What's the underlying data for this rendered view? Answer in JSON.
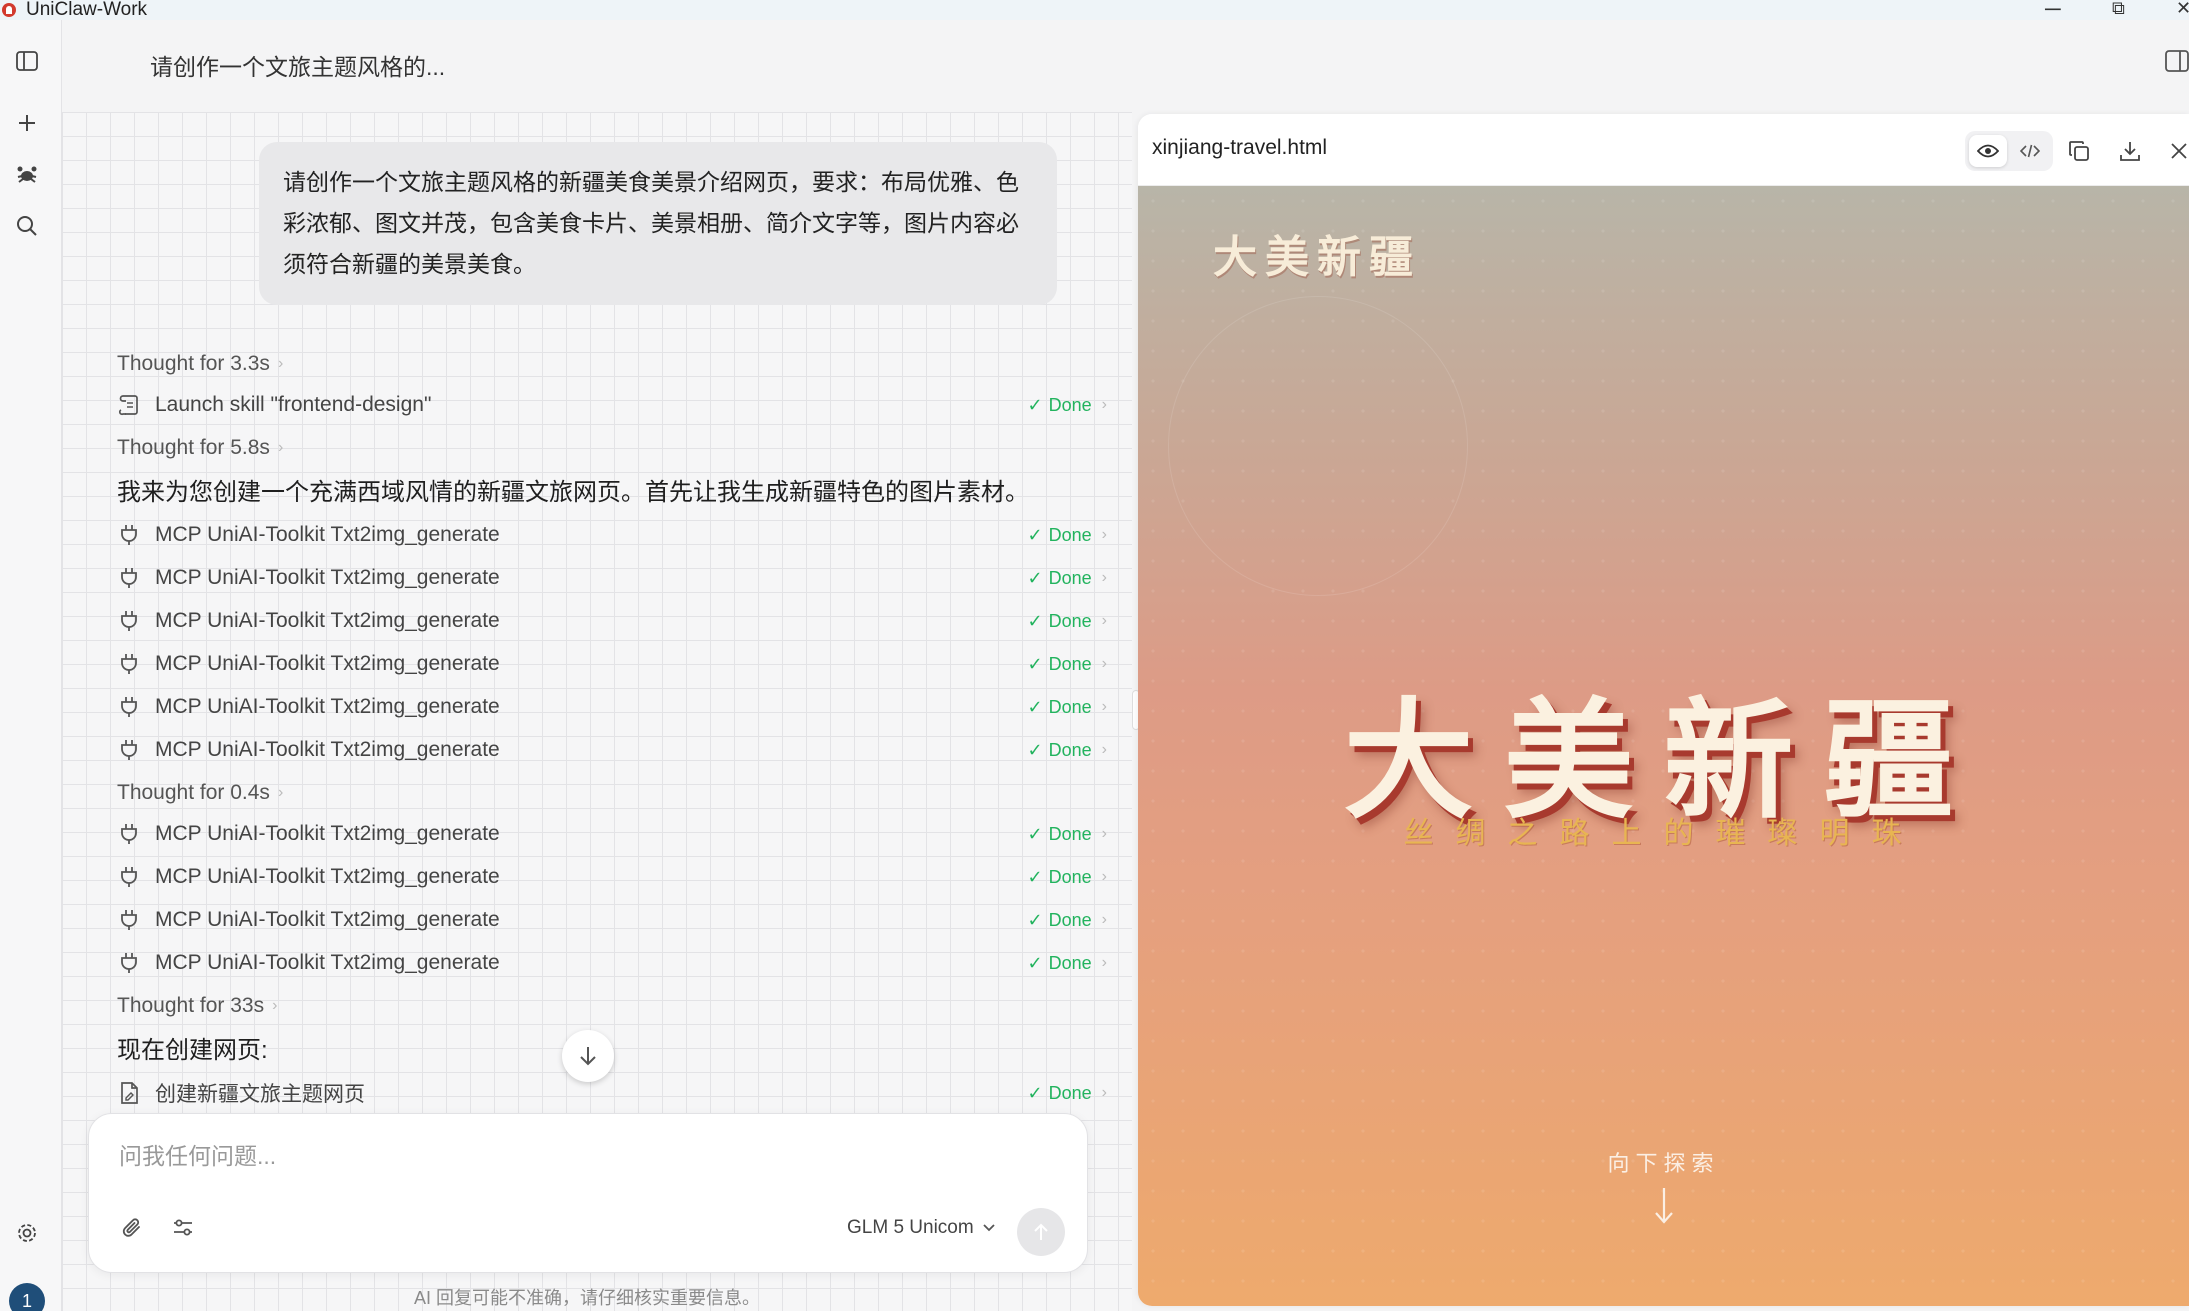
{
  "window": {
    "app_title": "UniClaw-Work",
    "minimize_glyph": "─",
    "restore_glyph": "⧉",
    "close_glyph": "✕"
  },
  "header": {
    "conversation_title": "请创作一个文旅主题风格的..."
  },
  "chat": {
    "user_message": "请创作一个文旅主题风格的新疆美食美景介绍网页，要求：布局优雅、色彩浓郁、图文并茂，包含美食卡片、美景相册、简介文字等，图片内容必须符合新疆的美景美食。",
    "items": [
      {
        "kind": "thought",
        "text": "Thought for 3.3s"
      },
      {
        "kind": "tool",
        "icon": "skill-icon",
        "text": "Launch skill \"frontend-design\"",
        "status": "Done"
      },
      {
        "kind": "thought",
        "text": "Thought for 5.8s"
      },
      {
        "kind": "prose",
        "text": "我来为您创建一个充满西域风情的新疆文旅网页。首先让我生成新疆特色的图片素材。"
      },
      {
        "kind": "tool",
        "icon": "plug-icon",
        "text": "MCP UniAI-Toolkit Txt2img_generate",
        "status": "Done"
      },
      {
        "kind": "tool",
        "icon": "plug-icon",
        "text": "MCP UniAI-Toolkit Txt2img_generate",
        "status": "Done"
      },
      {
        "kind": "tool",
        "icon": "plug-icon",
        "text": "MCP UniAI-Toolkit Txt2img_generate",
        "status": "Done"
      },
      {
        "kind": "tool",
        "icon": "plug-icon",
        "text": "MCP UniAI-Toolkit Txt2img_generate",
        "status": "Done"
      },
      {
        "kind": "tool",
        "icon": "plug-icon",
        "text": "MCP UniAI-Toolkit Txt2img_generate",
        "status": "Done"
      },
      {
        "kind": "tool",
        "icon": "plug-icon",
        "text": "MCP UniAI-Toolkit Txt2img_generate",
        "status": "Done"
      },
      {
        "kind": "thought",
        "text": "Thought for 0.4s"
      },
      {
        "kind": "tool",
        "icon": "plug-icon",
        "text": "MCP UniAI-Toolkit Txt2img_generate",
        "status": "Done"
      },
      {
        "kind": "tool",
        "icon": "plug-icon",
        "text": "MCP UniAI-Toolkit Txt2img_generate",
        "status": "Done"
      },
      {
        "kind": "tool",
        "icon": "plug-icon",
        "text": "MCP UniAI-Toolkit Txt2img_generate",
        "status": "Done"
      },
      {
        "kind": "tool",
        "icon": "plug-icon",
        "text": "MCP UniAI-Toolkit Txt2img_generate",
        "status": "Done"
      },
      {
        "kind": "thought",
        "text": "Thought for 33s"
      },
      {
        "kind": "prose",
        "text": "现在创建网页:"
      },
      {
        "kind": "tool",
        "icon": "file-icon",
        "text": "创建新疆文旅主题网页",
        "status": "Done"
      }
    ]
  },
  "composer": {
    "placeholder": "问我任何问题...",
    "model_label": "GLM 5 Unicom",
    "disclaimer": "AI 回复可能不准确，请仔细核实重要信息。"
  },
  "preview": {
    "file_name": "xinjiang-travel.html",
    "active_view": "preview",
    "hero": {
      "logo_text": "大美新疆",
      "title": "大美新疆",
      "subtitle": "丝绸之路上的璀璨明珠",
      "explore_label": "向下探索"
    }
  },
  "sidebar": {
    "user_badge": "1"
  },
  "colors": {
    "done_green": "#22b35e",
    "hero_top": "#b8b5a8",
    "hero_bottom": "#eeaa6d",
    "title_shadow": "#a83a2e",
    "subtitle_gold": "#e8b552",
    "avatar_blue": "#1f4e79"
  }
}
